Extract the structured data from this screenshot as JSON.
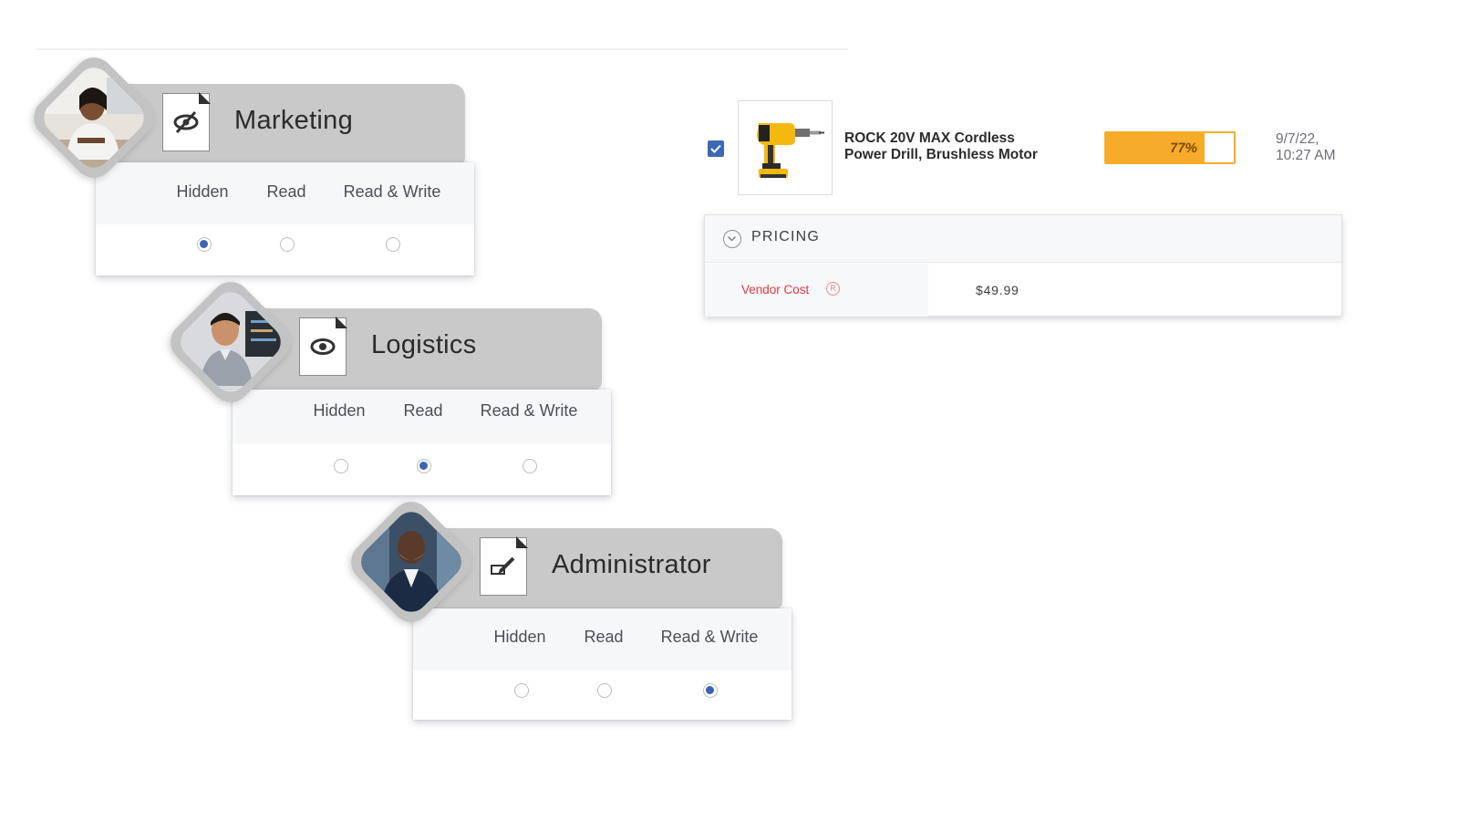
{
  "permissions": {
    "options": [
      "Hidden",
      "Read",
      "Read & Write"
    ],
    "roles": [
      {
        "name": "Marketing",
        "icon": "eye-slash-document-icon",
        "selected": "Hidden"
      },
      {
        "name": "Logistics",
        "icon": "eye-document-icon",
        "selected": "Read"
      },
      {
        "name": "Administrator",
        "icon": "edit-document-icon",
        "selected": "Read & Write"
      }
    ]
  },
  "product": {
    "checked": true,
    "name_line1": "ROCK 20V MAX Cordless",
    "name_line2": "Power Drill, Brushless Motor",
    "progress_percent": 77,
    "progress_label": "77%",
    "date_line1": "9/7/22,",
    "date_line2": "10:27 AM",
    "image_icon": "cordless-drill-icon"
  },
  "pricing": {
    "title": "PRICING",
    "vendor_cost_label": "Vendor Cost",
    "badge": "R",
    "vendor_cost_value": "$49.99"
  },
  "colors": {
    "accent_blue": "#3d63b4",
    "progress_orange": "#f6ab2b",
    "vendor_red": "#e0393e",
    "header_gray": "#c9c9c9"
  }
}
